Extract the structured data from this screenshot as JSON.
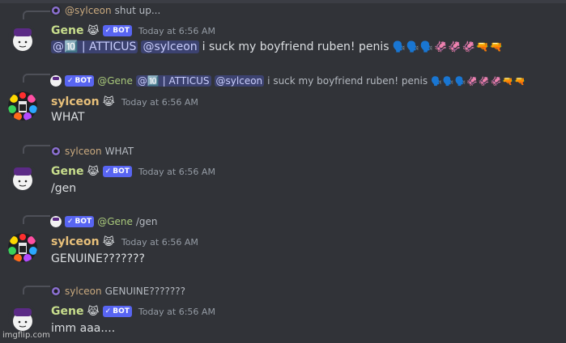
{
  "messages": [
    {
      "reply": {
        "author": "@sylceon",
        "text": "shut up..."
      },
      "author": "Gene",
      "crown": "😹",
      "bot_label": "BOT",
      "time": "Today at 6:56 AM",
      "body_mentions": [
        "@🔟 | ATTICUS",
        "@sylceon"
      ],
      "body_text": "i suck my boyfriend ruben! penis",
      "body_emoji": "🗣️🗣️🗣️🦑🦑🦑🔫🔫"
    },
    {
      "reply": {
        "author": "@Gene",
        "bot_label": "BOT",
        "mentions": [
          "@🔟 | ATTICUS",
          "@sylceon"
        ],
        "text": "i suck my boyfriend ruben! penis",
        "emoji": "🗣️🗣️🗣️🦑🦑🦑🔫🔫"
      },
      "author": "sylceon",
      "crown": "😹",
      "time": "Today at 6:56 AM",
      "body_text": "WHAT"
    },
    {
      "reply": {
        "author": "sylceon",
        "text": "WHAT"
      },
      "author": "Gene",
      "crown": "😹",
      "bot_label": "BOT",
      "time": "Today at 6:56 AM",
      "body_text": "/gen"
    },
    {
      "reply": {
        "author": "@Gene",
        "bot_label": "BOT",
        "text": "/gen"
      },
      "author": "sylceon",
      "crown": "😹",
      "time": "Today at 6:56 AM",
      "body_text": "GENUINE???????"
    },
    {
      "reply": {
        "author": "sylceon",
        "text": "GENUINE???????"
      },
      "author": "Gene",
      "crown": "😹",
      "bot_label": "BOT",
      "time": "Today at 6:56 AM",
      "body_text": "imm aaa...."
    }
  ],
  "watermark": "imgflip.com",
  "icons": {
    "bot_check": "checkmark-icon",
    "gene_avatar": "purple-hat-face-avatar",
    "sylceon_avatar": "rainbow-flower-avatar"
  }
}
